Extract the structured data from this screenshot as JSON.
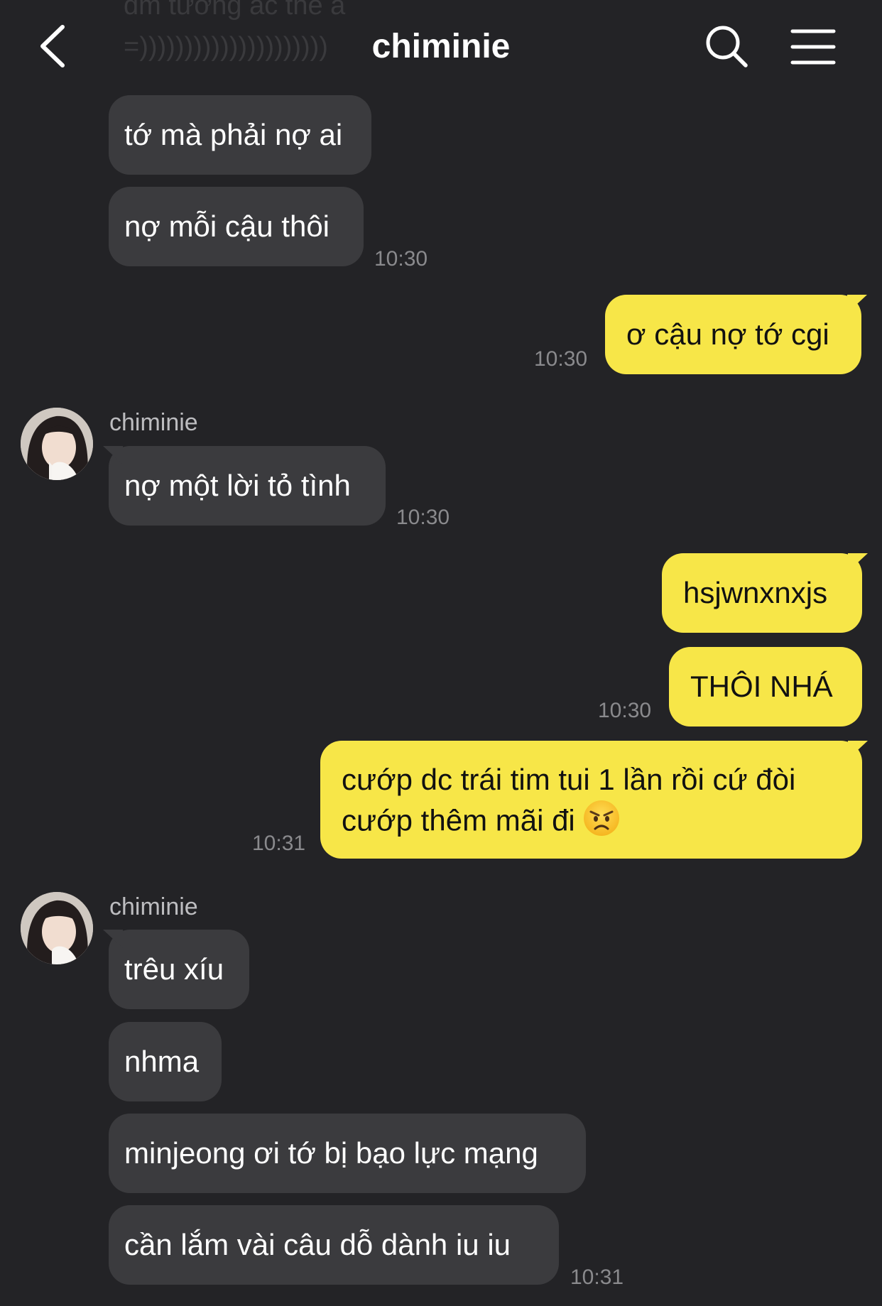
{
  "header": {
    "title": "chiminie",
    "ghost_line1": "đm tưởng ác thế à",
    "ghost_line2": "=)))))))))))))))))))))"
  },
  "messages": [
    {
      "side": "in",
      "text": "tớ mà phải nợ ai"
    },
    {
      "side": "in",
      "text": "nợ mỗi cậu thôi",
      "time": "10:30"
    },
    {
      "side": "out",
      "text": "ơ cậu nợ tớ cgi",
      "time": "10:30"
    },
    {
      "side": "in",
      "sender": "chiminie",
      "text": "nợ một lời tỏ tình",
      "time": "10:30"
    },
    {
      "side": "out",
      "text": "hsjwnxnxjs"
    },
    {
      "side": "out",
      "text": "THÔI NHÁ",
      "time": "10:30"
    },
    {
      "side": "out",
      "text": "cướp dc trái tim tui 1 lần rồi cứ đòi cướp thêm mãi đi",
      "emoji": "angry-face",
      "time": "10:31"
    },
    {
      "side": "in",
      "sender": "chiminie",
      "text": "trêu xíu"
    },
    {
      "side": "in",
      "text": "nhma"
    },
    {
      "side": "in",
      "text": "minjeong ơi tớ bị bạo lực mạng"
    },
    {
      "side": "in",
      "text": "cần lắm vài câu dỗ dành iu iu",
      "time": "10:31"
    }
  ],
  "colors": {
    "background": "#232326",
    "incoming_bubble": "#3b3b3e",
    "outgoing_bubble": "#f7e648",
    "timestamp": "#8a8a8d"
  }
}
